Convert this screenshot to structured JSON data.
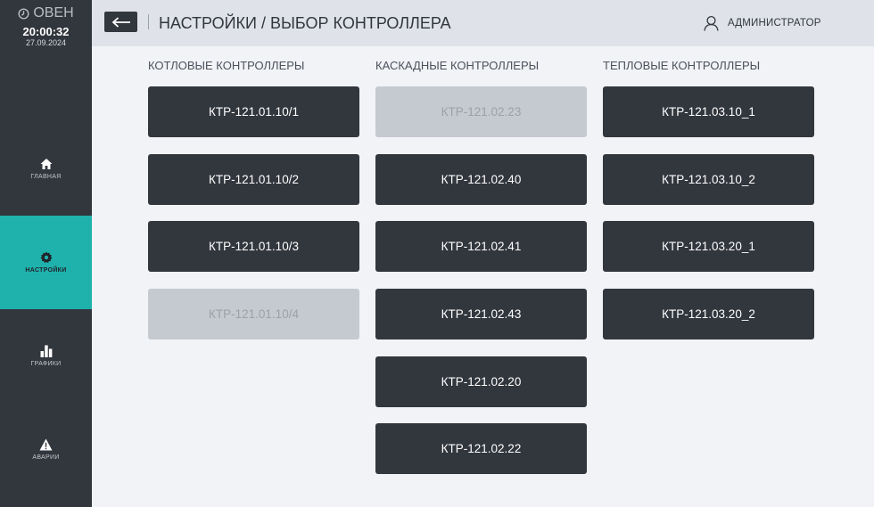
{
  "app": {
    "logo": "ОВЕН"
  },
  "clock": {
    "time": "20:00:32",
    "date": "27.09.2024"
  },
  "nav": {
    "home": "ГЛАВНАЯ",
    "settings": "НАСТРОЙКИ",
    "charts": "ГРАФИКИ",
    "alarms": "АВАРИИ",
    "active": "settings"
  },
  "header": {
    "title": "НАСТРОЙКИ / ВЫБОР КОНТРОЛЛЕРА",
    "user": "АДМИНИСТРАТОР"
  },
  "columns": [
    {
      "header": "КОТЛОВЫЕ КОНТРОЛЛЕРЫ",
      "items": [
        {
          "label": "КТР-121.01.10/1",
          "enabled": true
        },
        {
          "label": "КТР-121.01.10/2",
          "enabled": true
        },
        {
          "label": "КТР-121.01.10/3",
          "enabled": true
        },
        {
          "label": "КТР-121.01.10/4",
          "enabled": false
        }
      ]
    },
    {
      "header": "КАСКАДНЫЕ КОНТРОЛЛЕРЫ",
      "items": [
        {
          "label": "КТР-121.02.23",
          "enabled": false
        },
        {
          "label": "КТР-121.02.40",
          "enabled": true
        },
        {
          "label": "КТР-121.02.41",
          "enabled": true
        },
        {
          "label": "КТР-121.02.43",
          "enabled": true
        },
        {
          "label": "КТР-121.02.20",
          "enabled": true
        },
        {
          "label": "КТР-121.02.22",
          "enabled": true
        }
      ]
    },
    {
      "header": "ТЕПЛОВЫЕ КОНТРОЛЛЕРЫ",
      "items": [
        {
          "label": "КТР-121.03.10_1",
          "enabled": true
        },
        {
          "label": "КТР-121.03.10_2",
          "enabled": true
        },
        {
          "label": "КТР-121.03.20_1",
          "enabled": true
        },
        {
          "label": "КТР-121.03.20_2",
          "enabled": true
        }
      ]
    }
  ],
  "colors": {
    "sidebar": "#32363d",
    "accent": "#1fb2ad",
    "button": "#32363d",
    "button_disabled": "#c5c9d0"
  }
}
